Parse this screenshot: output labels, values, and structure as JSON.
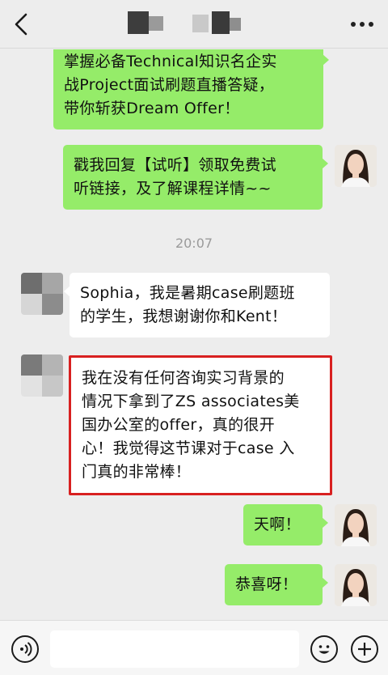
{
  "header": {
    "back_icon": "chevron-left-icon",
    "more_icon": "ellipsis-icon"
  },
  "messages": [
    {
      "sender": "me",
      "text": "掌握必备Technical知识名企实\n战Project面试刷题直播答疑，\n带你斩获Dream Offer！"
    },
    {
      "sender": "me",
      "text": "戳我回复【试听】领取免费试\n听链接，及了解课程详情~~"
    },
    {
      "sender": "them",
      "text": "Sophia，我是暑期case刷题班\n的学生，我想谢谢你和Kent！"
    },
    {
      "sender": "them",
      "text": "我在没有任何咨询实习背景的\n情况下拿到了ZS associates美\n国办公室的offer，真的很开\n心！我觉得这节课对于case 入\n门真的非常棒！",
      "highlighted": true
    },
    {
      "sender": "me",
      "text": "天啊！"
    },
    {
      "sender": "me",
      "text": "恭喜呀！"
    }
  ],
  "timestamp": "20:07",
  "input_bar": {
    "voice_icon": "voice-icon",
    "emoji_icon": "emoji-icon",
    "plus_icon": "plus-icon",
    "placeholder": ""
  },
  "colors": {
    "my_bubble": "#95ec69",
    "their_bubble": "#ffffff",
    "background": "#ededed",
    "highlight_border": "#d82020"
  }
}
